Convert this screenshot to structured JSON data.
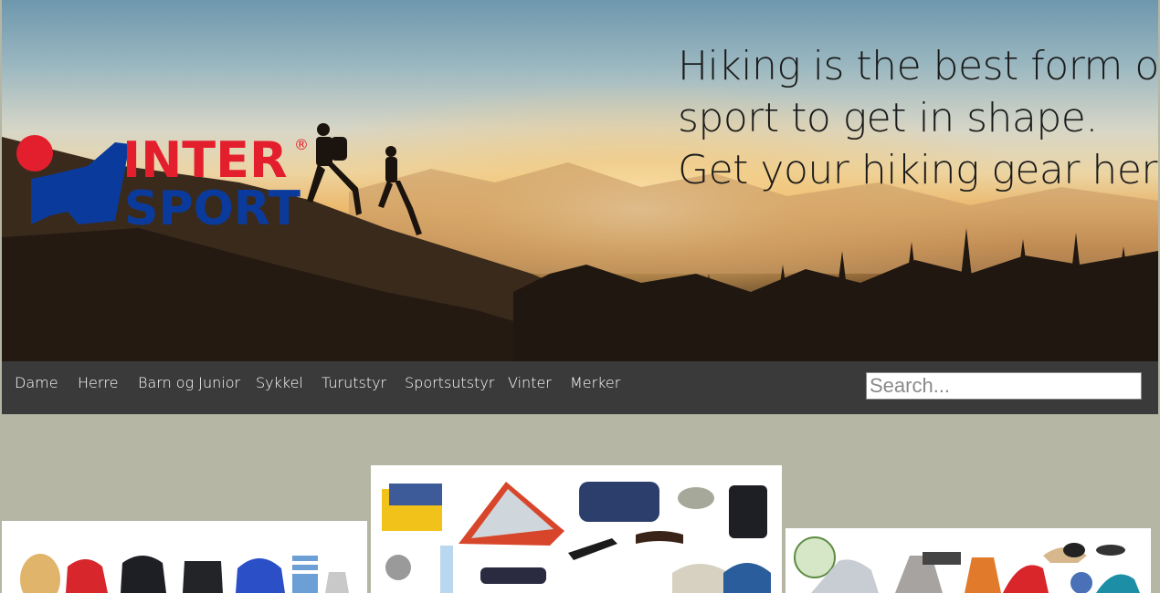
{
  "hero": {
    "headline_lines": [
      "Hiking is the best form of",
      "sport to get in shape.",
      "Get your hiking gear here."
    ],
    "logo": {
      "line1": "INTER",
      "line2": "SPORT",
      "registered": "®",
      "red": "#e41f2d",
      "blue": "#0a3b9c"
    }
  },
  "nav": {
    "items": [
      "Dame",
      "Herre",
      "Barn og Junior",
      "Sykkel",
      "Turutstyr",
      "Sportsutstyr",
      "Vinter",
      "Merker"
    ],
    "search_placeholder": "Search..."
  },
  "colors": {
    "nav_background": "#3a3a3a",
    "page_background": "#b5b6a4",
    "card_background": "#ffffff"
  },
  "product_cards": {
    "left": "hiking-clothing-collage",
    "center": "hiking-gear-collage",
    "right": "camping-equipment-collage"
  }
}
